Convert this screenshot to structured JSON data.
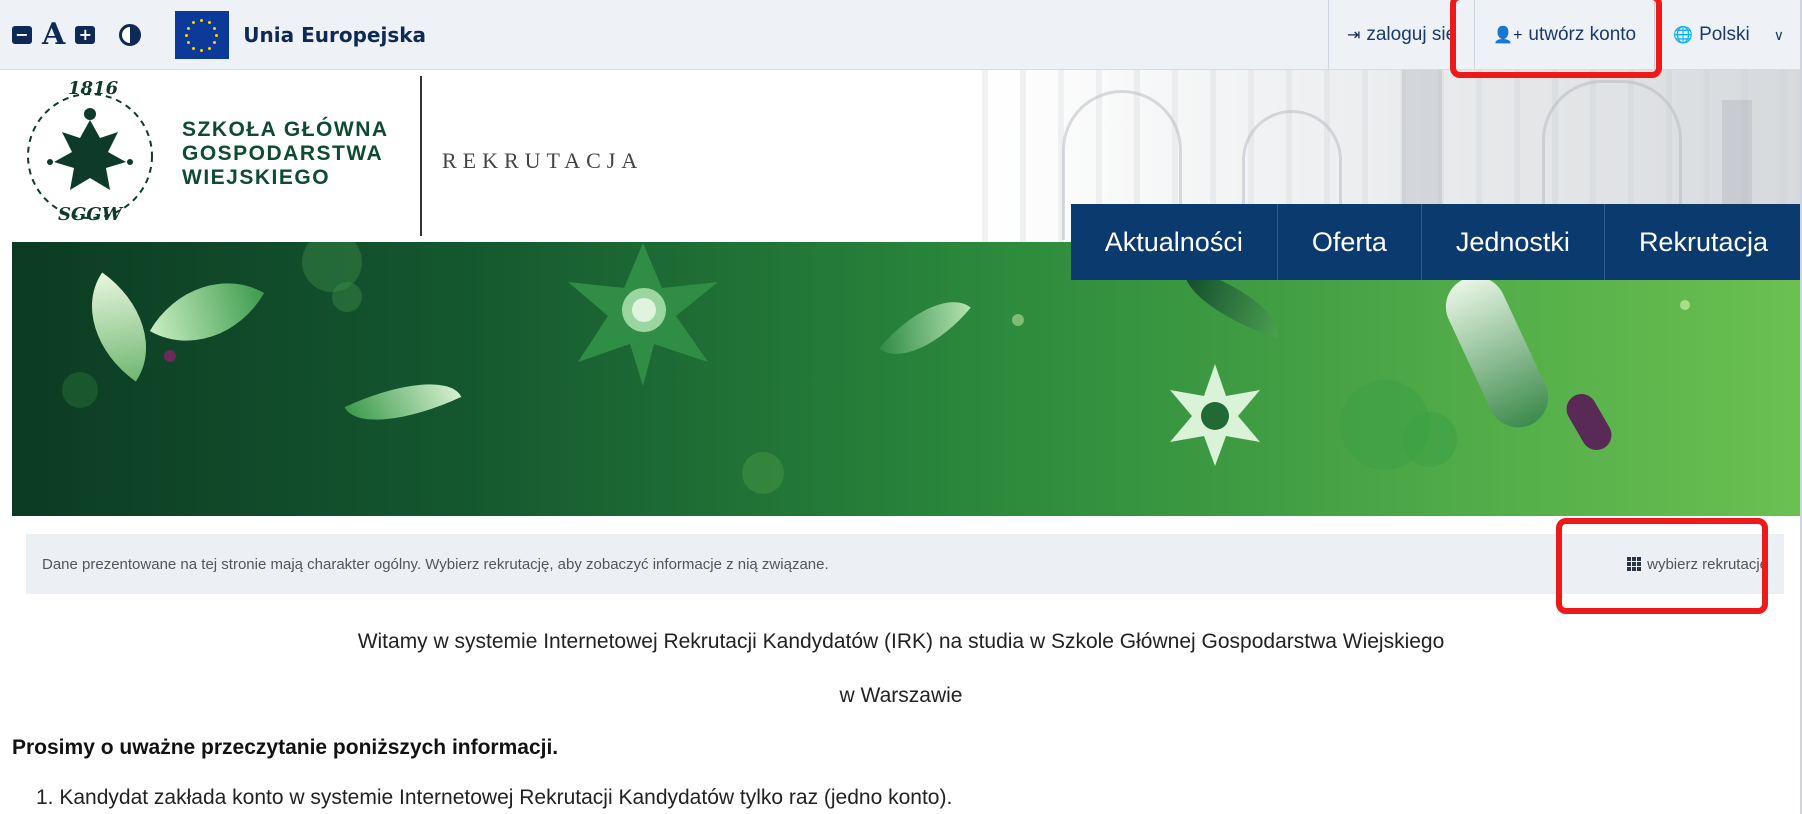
{
  "accessibility": {
    "decrease_font_icon": "minus-square-icon",
    "font_size_label": "A",
    "increase_font_icon": "plus-square-icon",
    "contrast_icon": "contrast-icon"
  },
  "eu": {
    "label": "Unia Europejska"
  },
  "top_links": {
    "login_label": "zaloguj się",
    "create_account_label": "utwórz konto",
    "language_label": "Polski"
  },
  "header": {
    "seal_year": "1816",
    "seal_abbr": "SGGW",
    "university_line1": "SZKOŁA GŁÓWNA",
    "university_line2": "GOSPODARSTWA",
    "university_line3": "WIEJSKIEGO",
    "section_label": "REKRUTACJA"
  },
  "nav": {
    "items": [
      "Aktualności",
      "Oferta",
      "Jednostki",
      "Rekrutacja"
    ]
  },
  "info_bar": {
    "text": "Dane prezentowane na tej stronie mają charakter ogólny. Wybierz rekrutację, aby zobaczyć informacje z nią związane.",
    "choose_label": "wybierz rekrutację"
  },
  "content": {
    "welcome_line1": "Witamy w systemie Internetowej Rekrutacji Kandydatów (IRK) na studia w Szkole Głównej Gospodarstwa Wiejskiego",
    "welcome_line2": "w Warszawie",
    "notice": "Prosimy o uważne przeczytanie poniższych informacji.",
    "list_item_1": "1. Kandydat zakłada konto w systemie Internetowej Rekrutacji Kandydatów tylko raz (jedno konto)."
  },
  "colors": {
    "navy": "#0b3a6e",
    "brand_green": "#0f4a32",
    "highlight_red": "#ee1a1a",
    "topbar_bg": "#eef1f6"
  }
}
